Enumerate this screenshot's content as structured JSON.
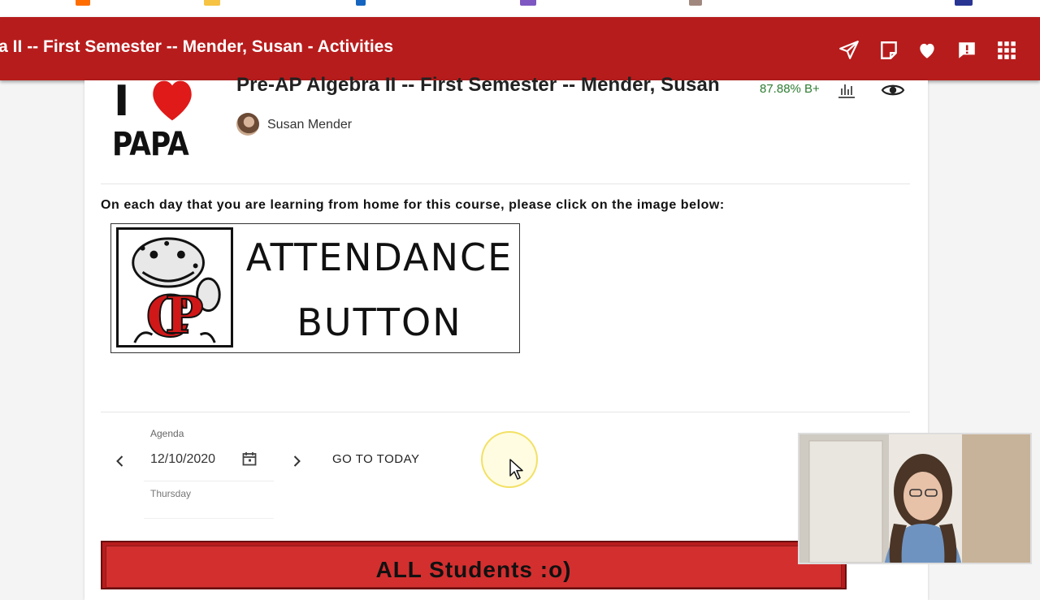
{
  "header": {
    "title": "ra II -- First Semester -- Mender, Susan - Activities",
    "icons": [
      "send-icon",
      "note-icon",
      "heart-icon",
      "alert-icon",
      "apps-grid-icon"
    ]
  },
  "logo": {
    "line1": "I",
    "line2": "PAPA"
  },
  "course": {
    "title": "Pre-AP Algebra II -- First Semester -- Mender, Susan",
    "grade": "87.88% B+",
    "teacher": "Susan Mender"
  },
  "instruction": "On each day that you are learning from home for this course, please click on the image below:",
  "attendance_button": {
    "line1": "ATTENDANCE",
    "line2": "BUTTON"
  },
  "agenda": {
    "label": "Agenda",
    "date": "12/10/2020",
    "weekday": "Thursday",
    "go_to_today": "GO TO TODAY"
  },
  "banner": {
    "text": "ALL Students :o)"
  },
  "colors": {
    "brand_red": "#b71c1c",
    "grade_green": "#2e7d32"
  }
}
